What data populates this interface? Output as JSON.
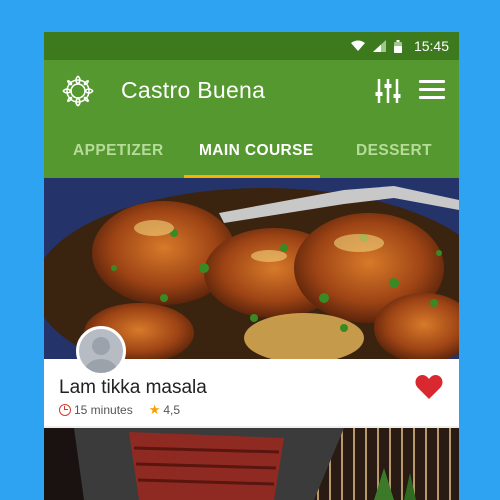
{
  "status": {
    "time": "15:45",
    "wifi_icon": "wifi-icon",
    "signal_icon": "signal-icon",
    "battery_icon": "battery-icon"
  },
  "app": {
    "title": "Castro Buena",
    "logo_icon": "mandala-logo-icon",
    "filter_icon": "sliders-icon",
    "menu_icon": "hamburger-menu-icon"
  },
  "tabs": [
    {
      "label": "APPETIZER",
      "active": false
    },
    {
      "label": "MAIN COURSE",
      "active": true
    },
    {
      "label": "DESSERT",
      "active": false
    }
  ],
  "cards": [
    {
      "title": "Lam tikka masala",
      "duration": "15 minutes",
      "rating": "4,5",
      "favorited": true
    }
  ],
  "colors": {
    "background": "#2ea3f2",
    "appbar": "#55982f",
    "statusbar": "#3d7a1e",
    "tab_indicator": "#f4b400",
    "heart": "#d9282f",
    "star": "#f4a000"
  }
}
